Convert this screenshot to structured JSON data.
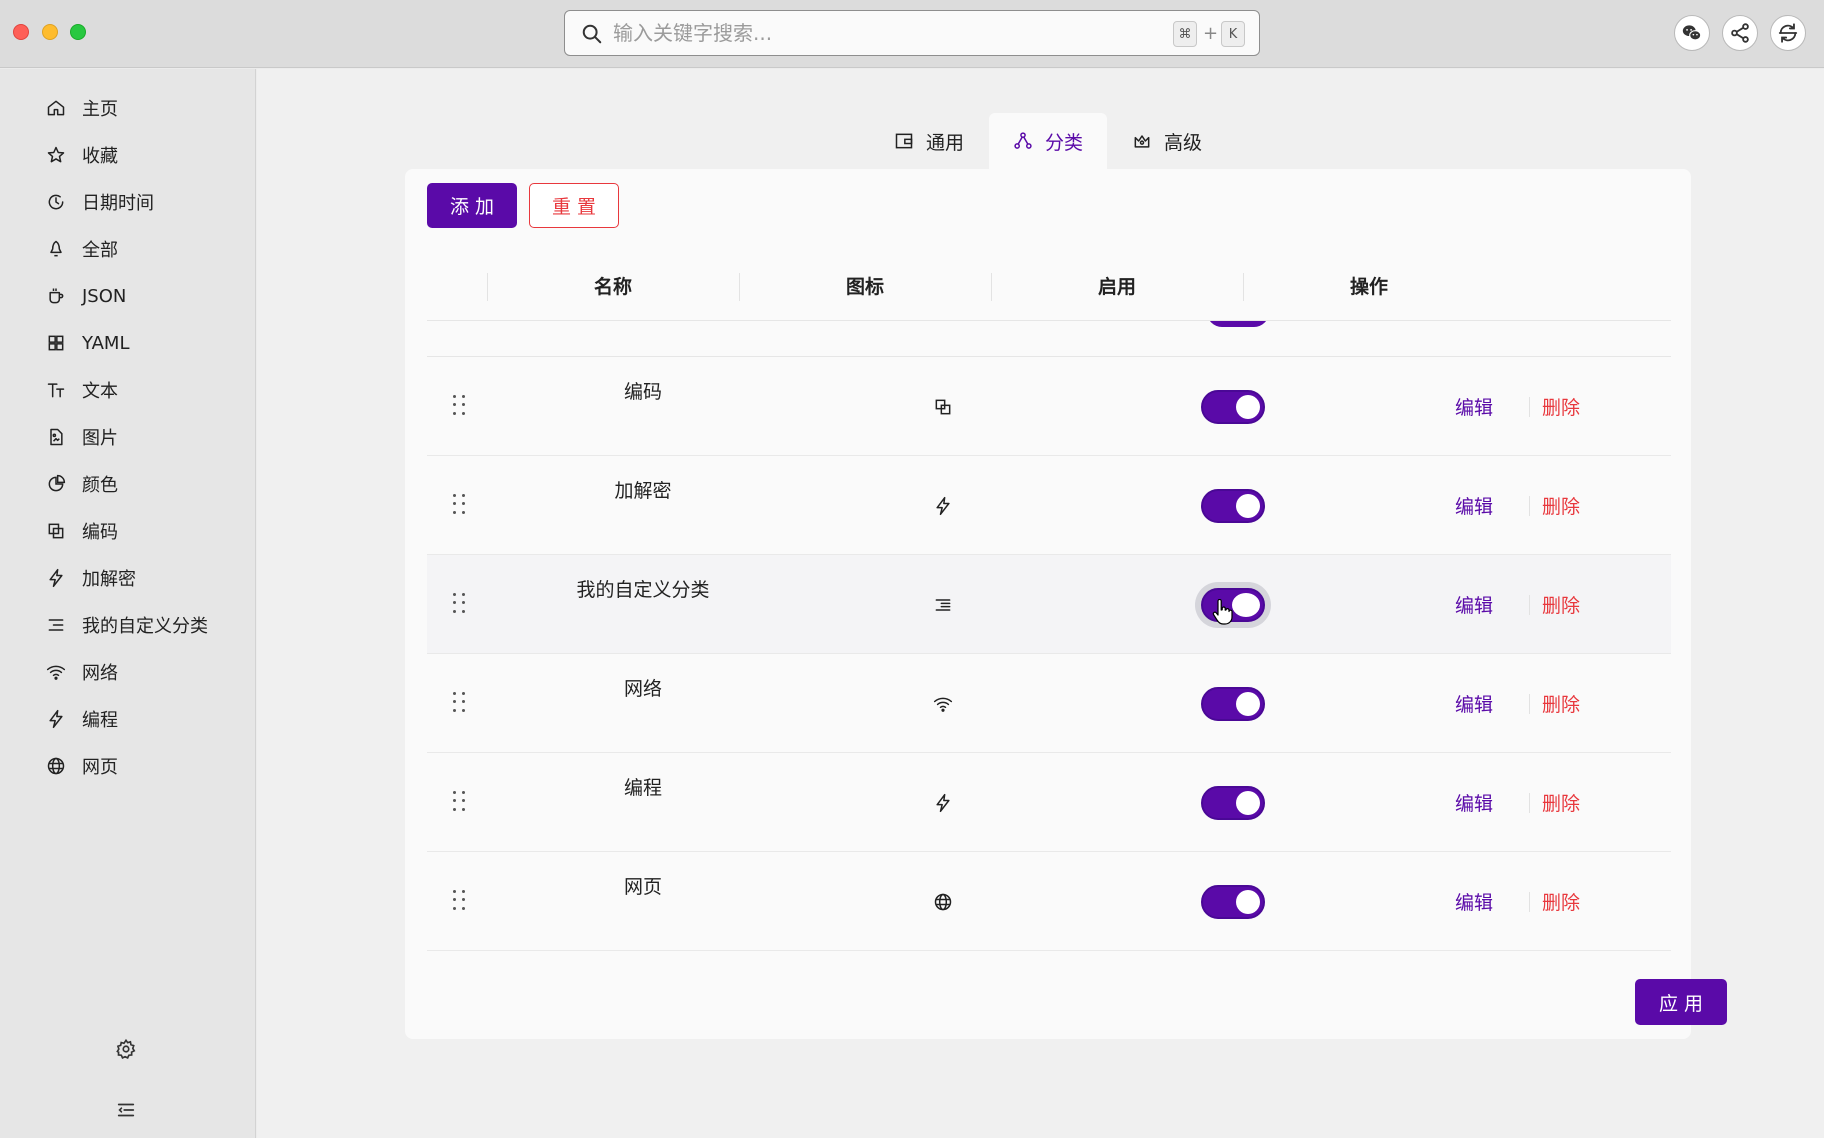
{
  "search": {
    "placeholder": "输入关键字搜索...",
    "shortcut_cmd": "⌘",
    "shortcut_plus": "+",
    "shortcut_key": "K"
  },
  "top_actions": [
    {
      "icon": "wechat-icon"
    },
    {
      "icon": "share-icon"
    },
    {
      "icon": "sync-icon"
    }
  ],
  "sidebar": {
    "items": [
      {
        "label": "主页",
        "icon": "home-icon"
      },
      {
        "label": "收藏",
        "icon": "star-icon"
      },
      {
        "label": "日期时间",
        "icon": "clock-icon"
      },
      {
        "label": "全部",
        "icon": "bell-icon"
      },
      {
        "label": "JSON",
        "icon": "cup-icon"
      },
      {
        "label": "YAML",
        "icon": "grid-icon"
      },
      {
        "label": "文本",
        "icon": "text-icon"
      },
      {
        "label": "图片",
        "icon": "file-image-icon"
      },
      {
        "label": "颜色",
        "icon": "pie-icon"
      },
      {
        "label": "编码",
        "icon": "copy-icon"
      },
      {
        "label": "加解密",
        "icon": "bolt-icon"
      },
      {
        "label": "我的自定义分类",
        "icon": "list-icon"
      },
      {
        "label": "网络",
        "icon": "wifi-icon"
      },
      {
        "label": "编程",
        "icon": "bolt-icon"
      },
      {
        "label": "网页",
        "icon": "globe-icon"
      }
    ],
    "bottom": [
      {
        "icon": "gear-icon"
      },
      {
        "icon": "collapse-menu-icon"
      }
    ]
  },
  "tabs": [
    {
      "label": "通用",
      "icon": "wallet-icon",
      "active": false
    },
    {
      "label": "分类",
      "icon": "nodes-icon",
      "active": true
    },
    {
      "label": "高级",
      "icon": "crown-icon",
      "active": false
    }
  ],
  "toolbar": {
    "add_label": "添加",
    "reset_label": "重置"
  },
  "table": {
    "columns": [
      "名称",
      "图标",
      "启用",
      "操作"
    ],
    "rows": [
      {
        "name": "编码",
        "icon": "copy-icon",
        "enabled": true,
        "edit": "编辑",
        "delete": "删除"
      },
      {
        "name": "加解密",
        "icon": "bolt-icon",
        "enabled": true,
        "edit": "编辑",
        "delete": "删除"
      },
      {
        "name": "我的自定义分类",
        "icon": "list-icon",
        "enabled": true,
        "edit": "编辑",
        "delete": "删除"
      },
      {
        "name": "网络",
        "icon": "wifi-icon",
        "enabled": true,
        "edit": "编辑",
        "delete": "删除"
      },
      {
        "name": "编程",
        "icon": "bolt-icon",
        "enabled": true,
        "edit": "编辑",
        "delete": "删除"
      },
      {
        "name": "网页",
        "icon": "globe-icon",
        "enabled": true,
        "edit": "编辑",
        "delete": "删除"
      }
    ]
  },
  "footer": {
    "apply_label": "应用"
  },
  "colors": {
    "accent": "#5a0aa8",
    "danger": "#e8383d"
  }
}
